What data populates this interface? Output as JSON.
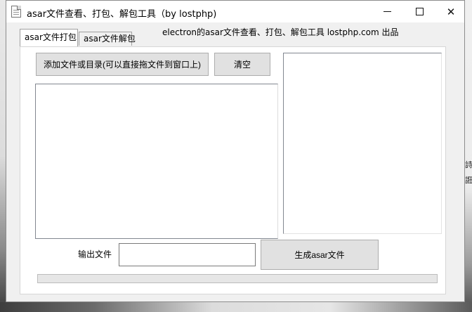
{
  "window": {
    "title": "asar文件查看、打包、解包工具（by lostphp)",
    "close_glyph": "✕",
    "icon": "document-icon"
  },
  "desktop": {
    "right_peek_top": "詩",
    "right_peek_bottom": "誑"
  },
  "tabs": [
    {
      "label": "asar文件打包",
      "active": true
    },
    {
      "label": "asar文件解包",
      "active": false
    }
  ],
  "tagline": "electron的asar文件查看、打包、解包工具 lostphp.com 出品",
  "pack": {
    "add_button": "添加文件或目录(可以直接拖文件到窗口上)",
    "clear_button": "清空",
    "output_label": "输出文件",
    "output_value": "",
    "output_placeholder": "",
    "generate_button": "生成asar文件",
    "progress": 0
  }
}
